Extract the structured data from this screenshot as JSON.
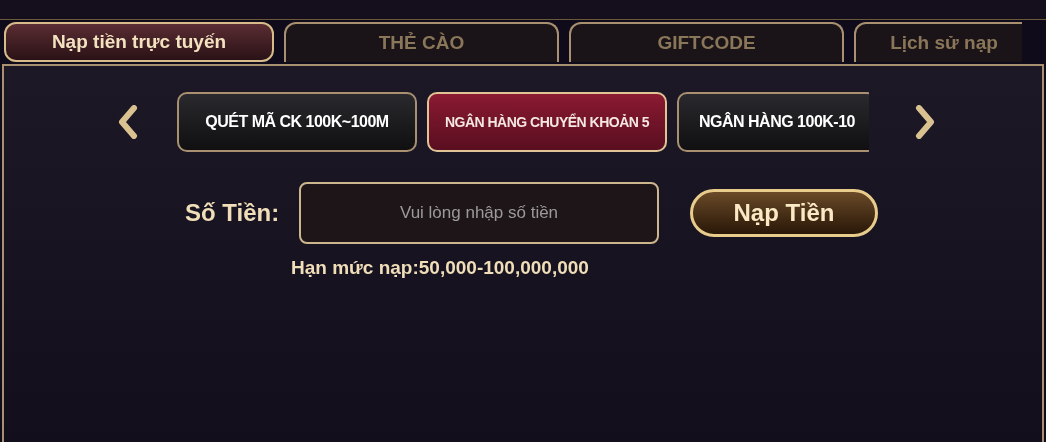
{
  "tabs": [
    {
      "label": "Nạp tiền trực tuyến",
      "selected": true
    },
    {
      "label": "THẺ CÀO",
      "selected": false
    },
    {
      "label": "GIFTCODE",
      "selected": false
    },
    {
      "label": "Lịch sử nạp",
      "selected": false
    }
  ],
  "methods": [
    {
      "label": "QUÉT MÃ CK 100K~100M",
      "selected": false
    },
    {
      "label": "NGÂN HÀNG CHUYỂN KHOẢN 5",
      "selected": true
    },
    {
      "label": "NGÂN HÀNG 100K-10",
      "selected": false
    }
  ],
  "amount": {
    "label": "Số Tiền:",
    "placeholder": "Vui lòng nhập số tiền"
  },
  "submit": "Nạp Tiền",
  "limit": "Hạn mức nạp:50,000-100,000,000"
}
